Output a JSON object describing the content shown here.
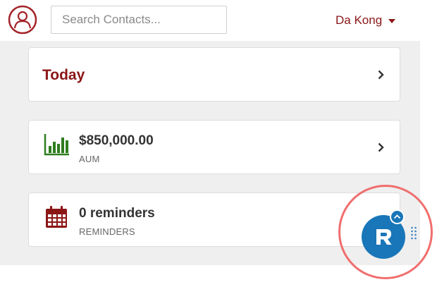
{
  "header": {
    "logo_icon": "user-circle-icon",
    "search": {
      "placeholder": "Search Contacts...",
      "value": ""
    },
    "user_name": "Da Kong",
    "user_menu_icon": "caret-down-icon"
  },
  "cards": {
    "today": {
      "title": "Today",
      "icon": "chevron-right-icon"
    },
    "aum": {
      "value": "$850,000.00",
      "label": "AUM",
      "icon": "bar-chart-icon"
    },
    "reminders": {
      "value": "0 reminders",
      "label": "REMINDERS",
      "icon": "calendar-icon"
    }
  },
  "floating_button": {
    "icon": "r-logo-icon",
    "badge_icon": "chevron-up-icon",
    "handle_icon": "drag-handle-icon"
  },
  "colors": {
    "brand": "#8b1616",
    "aum_green": "#2e7d1e",
    "fab_blue": "#1976b8",
    "highlight_ring": "#f06e6e",
    "content_bg": "#efefef"
  }
}
